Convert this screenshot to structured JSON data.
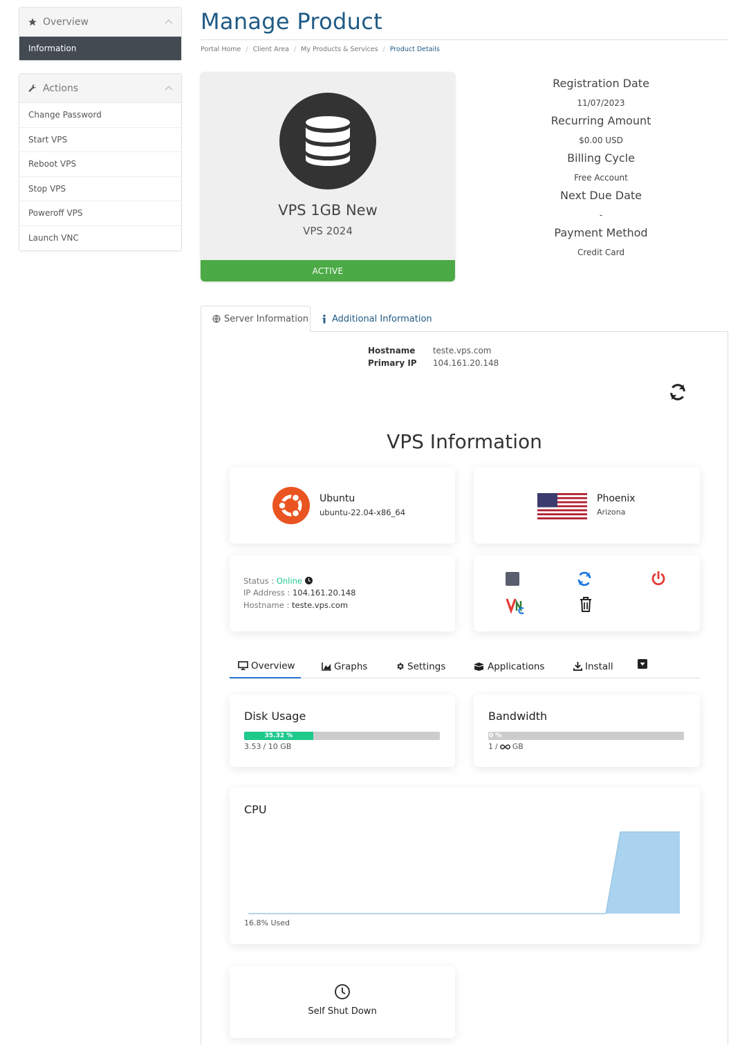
{
  "sidebar": {
    "overview": {
      "title": "Overview",
      "active_item": "Information"
    },
    "actions": {
      "title": "Actions",
      "items": [
        "Change Password",
        "Start VPS",
        "Reboot VPS",
        "Stop VPS",
        "Poweroff VPS",
        "Launch VNC"
      ]
    }
  },
  "header": {
    "title": "Manage Product",
    "breadcrumb": [
      "Portal Home",
      "Client Area",
      "My Products & Services",
      "Product Details"
    ]
  },
  "product": {
    "name": "VPS 1GB New",
    "group": "VPS 2024",
    "status": "ACTIVE",
    "status_color": "#4caa46"
  },
  "billing": {
    "registration_label": "Registration Date",
    "registration_value": "11/07/2023",
    "recurring_label": "Recurring Amount",
    "recurring_value": "$0.00 USD",
    "cycle_label": "Billing Cycle",
    "cycle_value": "Free Account",
    "due_label": "Next Due Date",
    "due_value": "-",
    "payment_label": "Payment Method",
    "payment_value": "Credit Card"
  },
  "tabs": {
    "server_info": "Server Information",
    "additional_info": "Additional Information"
  },
  "server": {
    "hostname_label": "Hostname",
    "hostname_value": "teste.vps.com",
    "ip_label": "Primary IP",
    "ip_value": "104.161.20.148"
  },
  "vps": {
    "title": "VPS Information",
    "os_name": "Ubuntu",
    "os_version": "ubuntu-22.04-x86_64",
    "location_city": "Phoenix",
    "location_state": "Arizona",
    "status_label": "Status :",
    "status_value": "Online",
    "ip_label": "IP Address :",
    "ip_value": "104.161.20.148",
    "hostname_label": "Hostname :",
    "hostname_value": "teste.vps.com"
  },
  "subtabs": [
    "Overview",
    "Graphs",
    "Settings",
    "Applications",
    "Install"
  ],
  "disk": {
    "title": "Disk Usage",
    "percent_label": "35.32 %",
    "percent": 35.32,
    "used": "3.53",
    "total_label": "/ 10 GB"
  },
  "bandwidth": {
    "title": "Bandwidth",
    "percent_label": "0 %",
    "percent": 0,
    "used": "1",
    "sep": "/",
    "total_label": "GB"
  },
  "cpu": {
    "title": "CPU",
    "used_label": "16.8% Used"
  },
  "shutdown": {
    "label": "Self Shut Down"
  },
  "colors": {
    "accent": "#1f5a85",
    "online": "#1ec98c",
    "danger": "#e53935",
    "refresh": "#1f78e0",
    "cpu_fill": "#a9d3ef"
  },
  "icons": [
    "star-icon",
    "chevron-up-icon",
    "wrench-icon",
    "database-icon",
    "globe-icon",
    "info-icon",
    "refresh-icon",
    "ubuntu-logo",
    "us-flag",
    "clock-icon",
    "stop-icon",
    "power-icon",
    "vnc-icon",
    "trash-icon",
    "monitor-icon",
    "chart-icon",
    "gear-icon",
    "boxes-icon",
    "download-icon",
    "caret-down-icon"
  ]
}
